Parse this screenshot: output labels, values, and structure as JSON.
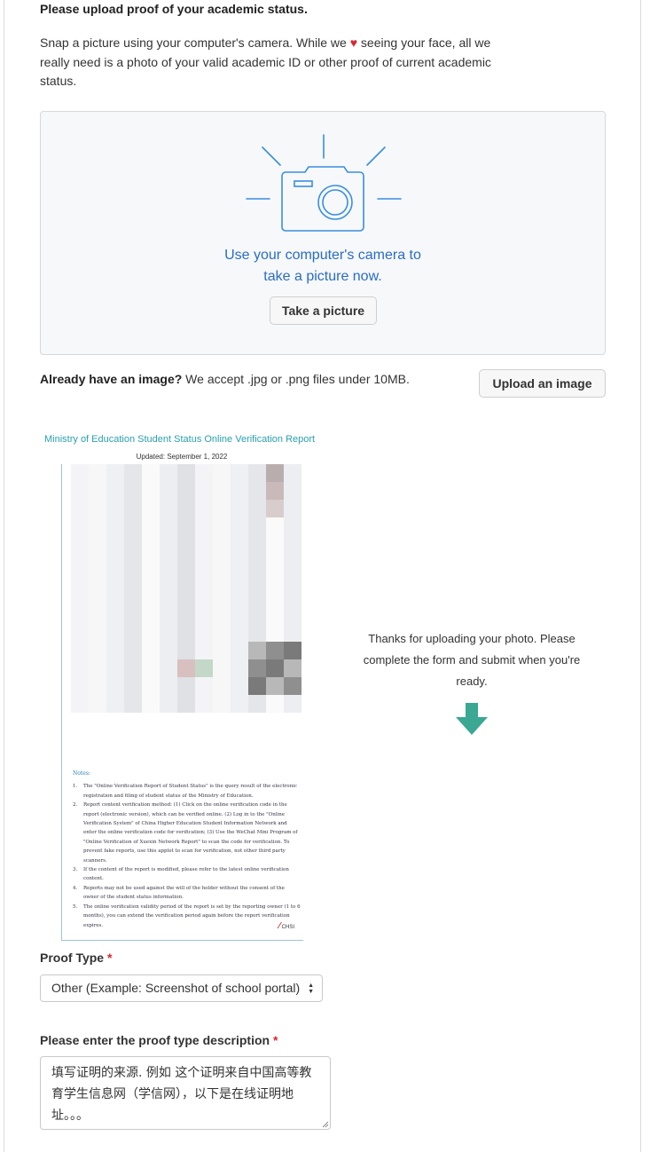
{
  "section": {
    "title": "Please upload proof of your academic status.",
    "intro_before_heart": "Snap a picture using your computer's camera. While we ",
    "heart": "♥",
    "intro_after_heart": " seeing your face, all we really need is a photo of your valid academic ID or other proof of current academic status."
  },
  "camera": {
    "icon": "camera-icon",
    "line1": "Use your computer's camera to",
    "line2": "take a picture now.",
    "button": "Take a picture"
  },
  "upload": {
    "bold": "Already have an image?",
    "text": " We accept .jpg or .png files under 10MB.",
    "button": "Upload an image"
  },
  "document": {
    "title": "Ministry of Education Student Status Online Verification Report",
    "updated": "Updated: September 1, 2022",
    "notes_title": "Notes:",
    "notes": [
      {
        "n": "1.",
        "text": "The \"Online Verification Report of Student Status\" is the query result of the electronic registration and filing of student status of the Ministry of Education."
      },
      {
        "n": "2.",
        "text": "Report content verification method: (1) Click on the online verification code in the report (electronic version), which can be verified online. (2) Log in to the \"Online Verification System\" of China Higher Education Student Information Network and enter the online verification code for verification; (3) Use the WeChat Mini Program of \"Online Verification of Xuexin Network Report\" to scan the code for verification. To prevent fake reports, use this applet to scan for verification, not other third party scanners."
      },
      {
        "n": "3.",
        "text": "If the content of the report is modified, please refer to the latest online verification content."
      },
      {
        "n": "4.",
        "text": "Reports may not be used against the will of the holder without the consent of the owner of the student status information."
      },
      {
        "n": "5.",
        "text": "The online verification validity period of the report is set by the reporting owner (1 to 6 months), you can extend the verification period again before the report verification expires."
      }
    ],
    "logo": "CHSI"
  },
  "thanks": {
    "text": "Thanks for uploading your photo. Please complete the form and submit when you're ready.",
    "icon": "down-arrow-icon",
    "color": "#3aa892"
  },
  "form": {
    "proof_type_label": "Proof Type",
    "required_mark": "*",
    "proof_type_value": "Other (Example: Screenshot of school portal)",
    "description_label": "Please enter the proof type description",
    "description_value": "填写证明的来源. 例如 这个证明来自中国高等教育学生信息网（学信网），以下是在线证明地址。。。"
  },
  "colors": {
    "accent_blue": "#2a6cc4",
    "heart_red": "#d9272e",
    "teal": "#3aa892"
  }
}
